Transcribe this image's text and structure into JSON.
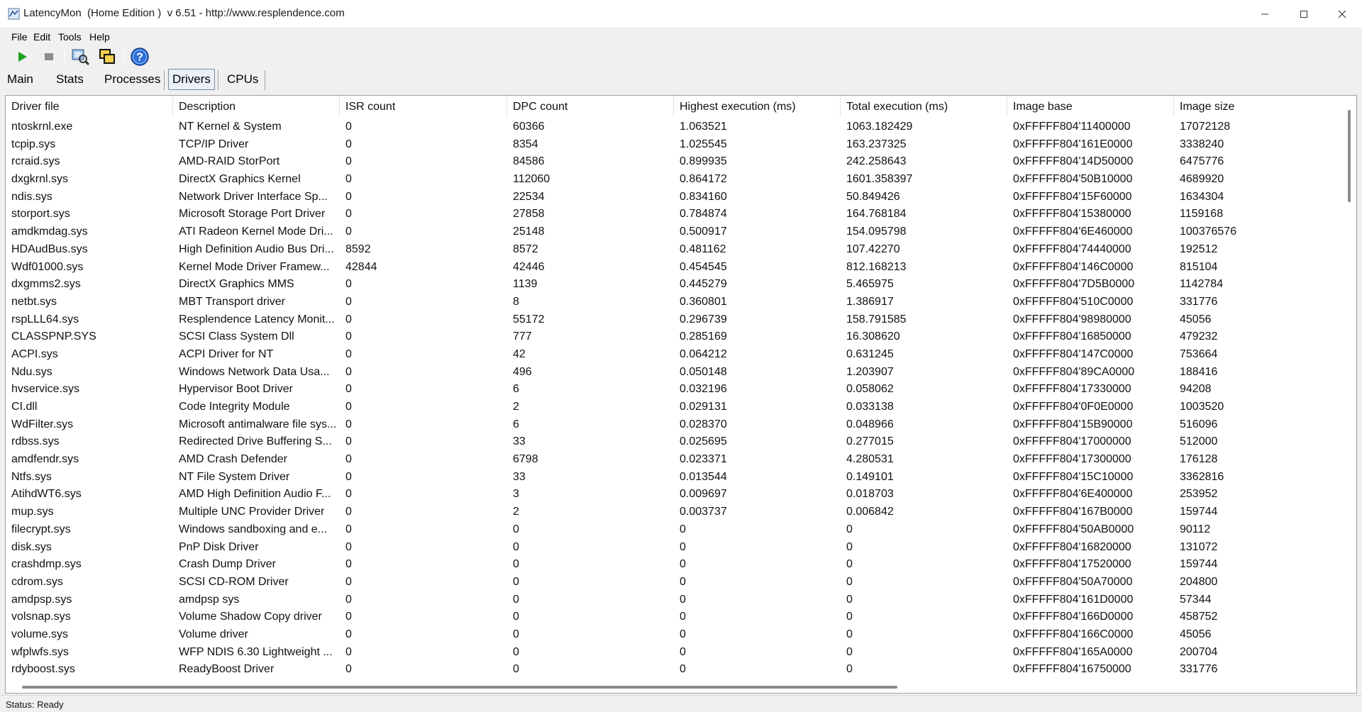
{
  "window": {
    "title": "LatencyMon  (Home Edition )  v 6.51 - http://www.resplendence.com"
  },
  "menu": [
    "File",
    "Edit",
    "Tools",
    "Help"
  ],
  "toolbar": {
    "icons": [
      "play-icon",
      "stop-icon",
      "search-driver-icon",
      "windows-icon",
      "help-icon"
    ],
    "help_glyph": "?"
  },
  "tabs": [
    "Main",
    "Stats",
    "Processes",
    "Drivers",
    "CPUs"
  ],
  "active_tab": "Drivers",
  "columns": [
    "Driver file",
    "Description",
    "ISR count",
    "DPC count",
    "Highest execution (ms)",
    "Total execution (ms)",
    "Image base",
    "Image size"
  ],
  "rows": [
    [
      "ntoskrnl.exe",
      "NT Kernel & System",
      "0",
      "60366",
      "1.063521",
      "1063.182429",
      "0xFFFFF804'11400000",
      "17072128"
    ],
    [
      "tcpip.sys",
      "TCP/IP Driver",
      "0",
      "8354",
      "1.025545",
      "163.237325",
      "0xFFFFF804'161E0000",
      "3338240"
    ],
    [
      "rcraid.sys",
      "AMD-RAID StorPort",
      "0",
      "84586",
      "0.899935",
      "242.258643",
      "0xFFFFF804'14D50000",
      "6475776"
    ],
    [
      "dxgkrnl.sys",
      "DirectX Graphics Kernel",
      "0",
      "112060",
      "0.864172",
      "1601.358397",
      "0xFFFFF804'50B10000",
      "4689920"
    ],
    [
      "ndis.sys",
      "Network Driver Interface Sp...",
      "0",
      "22534",
      "0.834160",
      "50.849426",
      "0xFFFFF804'15F60000",
      "1634304"
    ],
    [
      "storport.sys",
      "Microsoft Storage Port Driver",
      "0",
      "27858",
      "0.784874",
      "164.768184",
      "0xFFFFF804'15380000",
      "1159168"
    ],
    [
      "amdkmdag.sys",
      "ATI Radeon Kernel Mode Dri...",
      "0",
      "25148",
      "0.500917",
      "154.095798",
      "0xFFFFF804'6E460000",
      "100376576"
    ],
    [
      "HDAudBus.sys",
      "High Definition Audio Bus Dri...",
      "8592",
      "8572",
      "0.481162",
      "107.42270",
      "0xFFFFF804'74440000",
      "192512"
    ],
    [
      "Wdf01000.sys",
      "Kernel Mode Driver Framew...",
      "42844",
      "42446",
      "0.454545",
      "812.168213",
      "0xFFFFF804'146C0000",
      "815104"
    ],
    [
      "dxgmms2.sys",
      "DirectX Graphics MMS",
      "0",
      "1139",
      "0.445279",
      "5.465975",
      "0xFFFFF804'7D5B0000",
      "1142784"
    ],
    [
      "netbt.sys",
      "MBT Transport driver",
      "0",
      "8",
      "0.360801",
      "1.386917",
      "0xFFFFF804'510C0000",
      "331776"
    ],
    [
      "rspLLL64.sys",
      "Resplendence Latency Monit...",
      "0",
      "55172",
      "0.296739",
      "158.791585",
      "0xFFFFF804'98980000",
      "45056"
    ],
    [
      "CLASSPNP.SYS",
      "SCSI Class System Dll",
      "0",
      "777",
      "0.285169",
      "16.308620",
      "0xFFFFF804'16850000",
      "479232"
    ],
    [
      "ACPI.sys",
      "ACPI Driver for NT",
      "0",
      "42",
      "0.064212",
      "0.631245",
      "0xFFFFF804'147C0000",
      "753664"
    ],
    [
      "Ndu.sys",
      "Windows Network Data Usa...",
      "0",
      "496",
      "0.050148",
      "1.203907",
      "0xFFFFF804'89CA0000",
      "188416"
    ],
    [
      "hvservice.sys",
      "Hypervisor Boot Driver",
      "0",
      "6",
      "0.032196",
      "0.058062",
      "0xFFFFF804'17330000",
      "94208"
    ],
    [
      "CI.dll",
      "Code Integrity Module",
      "0",
      "2",
      "0.029131",
      "0.033138",
      "0xFFFFF804'0F0E0000",
      "1003520"
    ],
    [
      "WdFilter.sys",
      "Microsoft antimalware file sys...",
      "0",
      "6",
      "0.028370",
      "0.048966",
      "0xFFFFF804'15B90000",
      "516096"
    ],
    [
      "rdbss.sys",
      "Redirected Drive Buffering S...",
      "0",
      "33",
      "0.025695",
      "0.277015",
      "0xFFFFF804'17000000",
      "512000"
    ],
    [
      "amdfendr.sys",
      "AMD Crash Defender",
      "0",
      "6798",
      "0.023371",
      "4.280531",
      "0xFFFFF804'17300000",
      "176128"
    ],
    [
      "Ntfs.sys",
      "NT File System Driver",
      "0",
      "33",
      "0.013544",
      "0.149101",
      "0xFFFFF804'15C10000",
      "3362816"
    ],
    [
      "AtihdWT6.sys",
      "AMD High Definition Audio F...",
      "0",
      "3",
      "0.009697",
      "0.018703",
      "0xFFFFF804'6E400000",
      "253952"
    ],
    [
      "mup.sys",
      "Multiple UNC Provider Driver",
      "0",
      "2",
      "0.003737",
      "0.006842",
      "0xFFFFF804'167B0000",
      "159744"
    ],
    [
      "filecrypt.sys",
      "Windows sandboxing and e...",
      "0",
      "0",
      "0",
      "0",
      "0xFFFFF804'50AB0000",
      "90112"
    ],
    [
      "disk.sys",
      "PnP Disk Driver",
      "0",
      "0",
      "0",
      "0",
      "0xFFFFF804'16820000",
      "131072"
    ],
    [
      "crashdmp.sys",
      "Crash Dump Driver",
      "0",
      "0",
      "0",
      "0",
      "0xFFFFF804'17520000",
      "159744"
    ],
    [
      "cdrom.sys",
      "SCSI CD-ROM Driver",
      "0",
      "0",
      "0",
      "0",
      "0xFFFFF804'50A70000",
      "204800"
    ],
    [
      "amdpsp.sys",
      "amdpsp sys",
      "0",
      "0",
      "0",
      "0",
      "0xFFFFF804'161D0000",
      "57344"
    ],
    [
      "volsnap.sys",
      "Volume Shadow Copy driver",
      "0",
      "0",
      "0",
      "0",
      "0xFFFFF804'166D0000",
      "458752"
    ],
    [
      "volume.sys",
      "Volume driver",
      "0",
      "0",
      "0",
      "0",
      "0xFFFFF804'166C0000",
      "45056"
    ],
    [
      "wfplwfs.sys",
      "WFP NDIS 6.30 Lightweight ...",
      "0",
      "0",
      "0",
      "0",
      "0xFFFFF804'165A0000",
      "200704"
    ],
    [
      "rdyboost.sys",
      "ReadyBoost Driver",
      "0",
      "0",
      "0",
      "0",
      "0xFFFFF804'16750000",
      "331776"
    ]
  ],
  "status": "Status: Ready",
  "colors": {
    "play_green": "#1ea11e",
    "stop_gray": "#8c8c8c",
    "help_blue": "#2d6fd6",
    "active_tab_bg": "#eaf0f8"
  }
}
